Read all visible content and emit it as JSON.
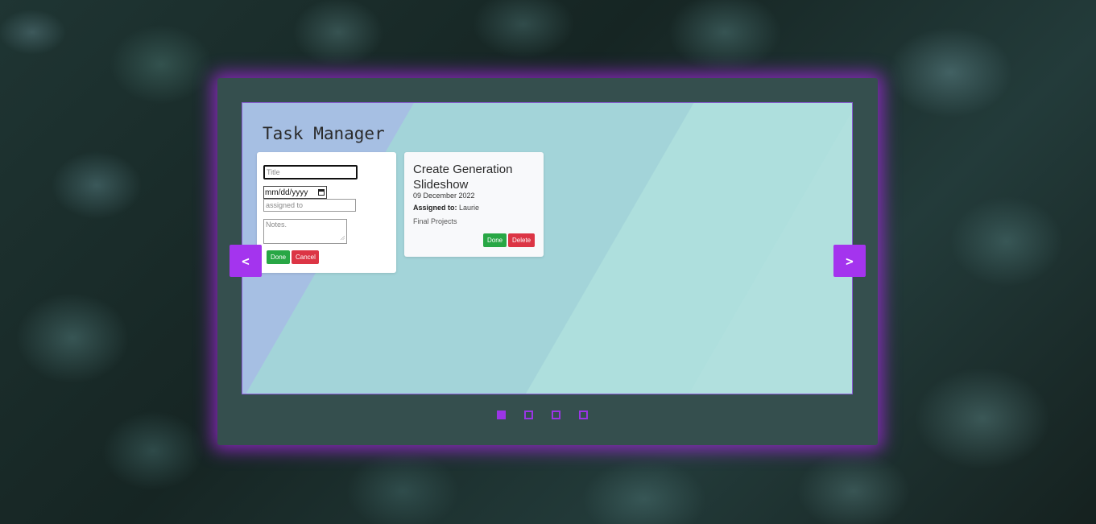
{
  "slide": {
    "title": "Task Manager"
  },
  "form": {
    "title_placeholder": "Title",
    "date_placeholder": "mm/dd/yyyy",
    "assigned_placeholder": "assigned to",
    "notes_placeholder": "Notes.",
    "done_label": "Done",
    "cancel_label": "Cancel"
  },
  "task": {
    "title": "Create Generation Slideshow",
    "date": "09 December 2022",
    "assigned_label": "Assigned to:",
    "assigned_value": "Laurie",
    "notes": "Final Projects",
    "done_label": "Done",
    "delete_label": "Delete"
  },
  "nav": {
    "prev_label": "<",
    "next_label": ">"
  },
  "pagination": {
    "active_index": 0,
    "count": 4
  },
  "colors": {
    "accent": "#a434ee",
    "done": "#28a745",
    "danger": "#dc3545",
    "panel": "#354f4e"
  },
  "icons": {
    "date_picker": "calendar-icon"
  }
}
